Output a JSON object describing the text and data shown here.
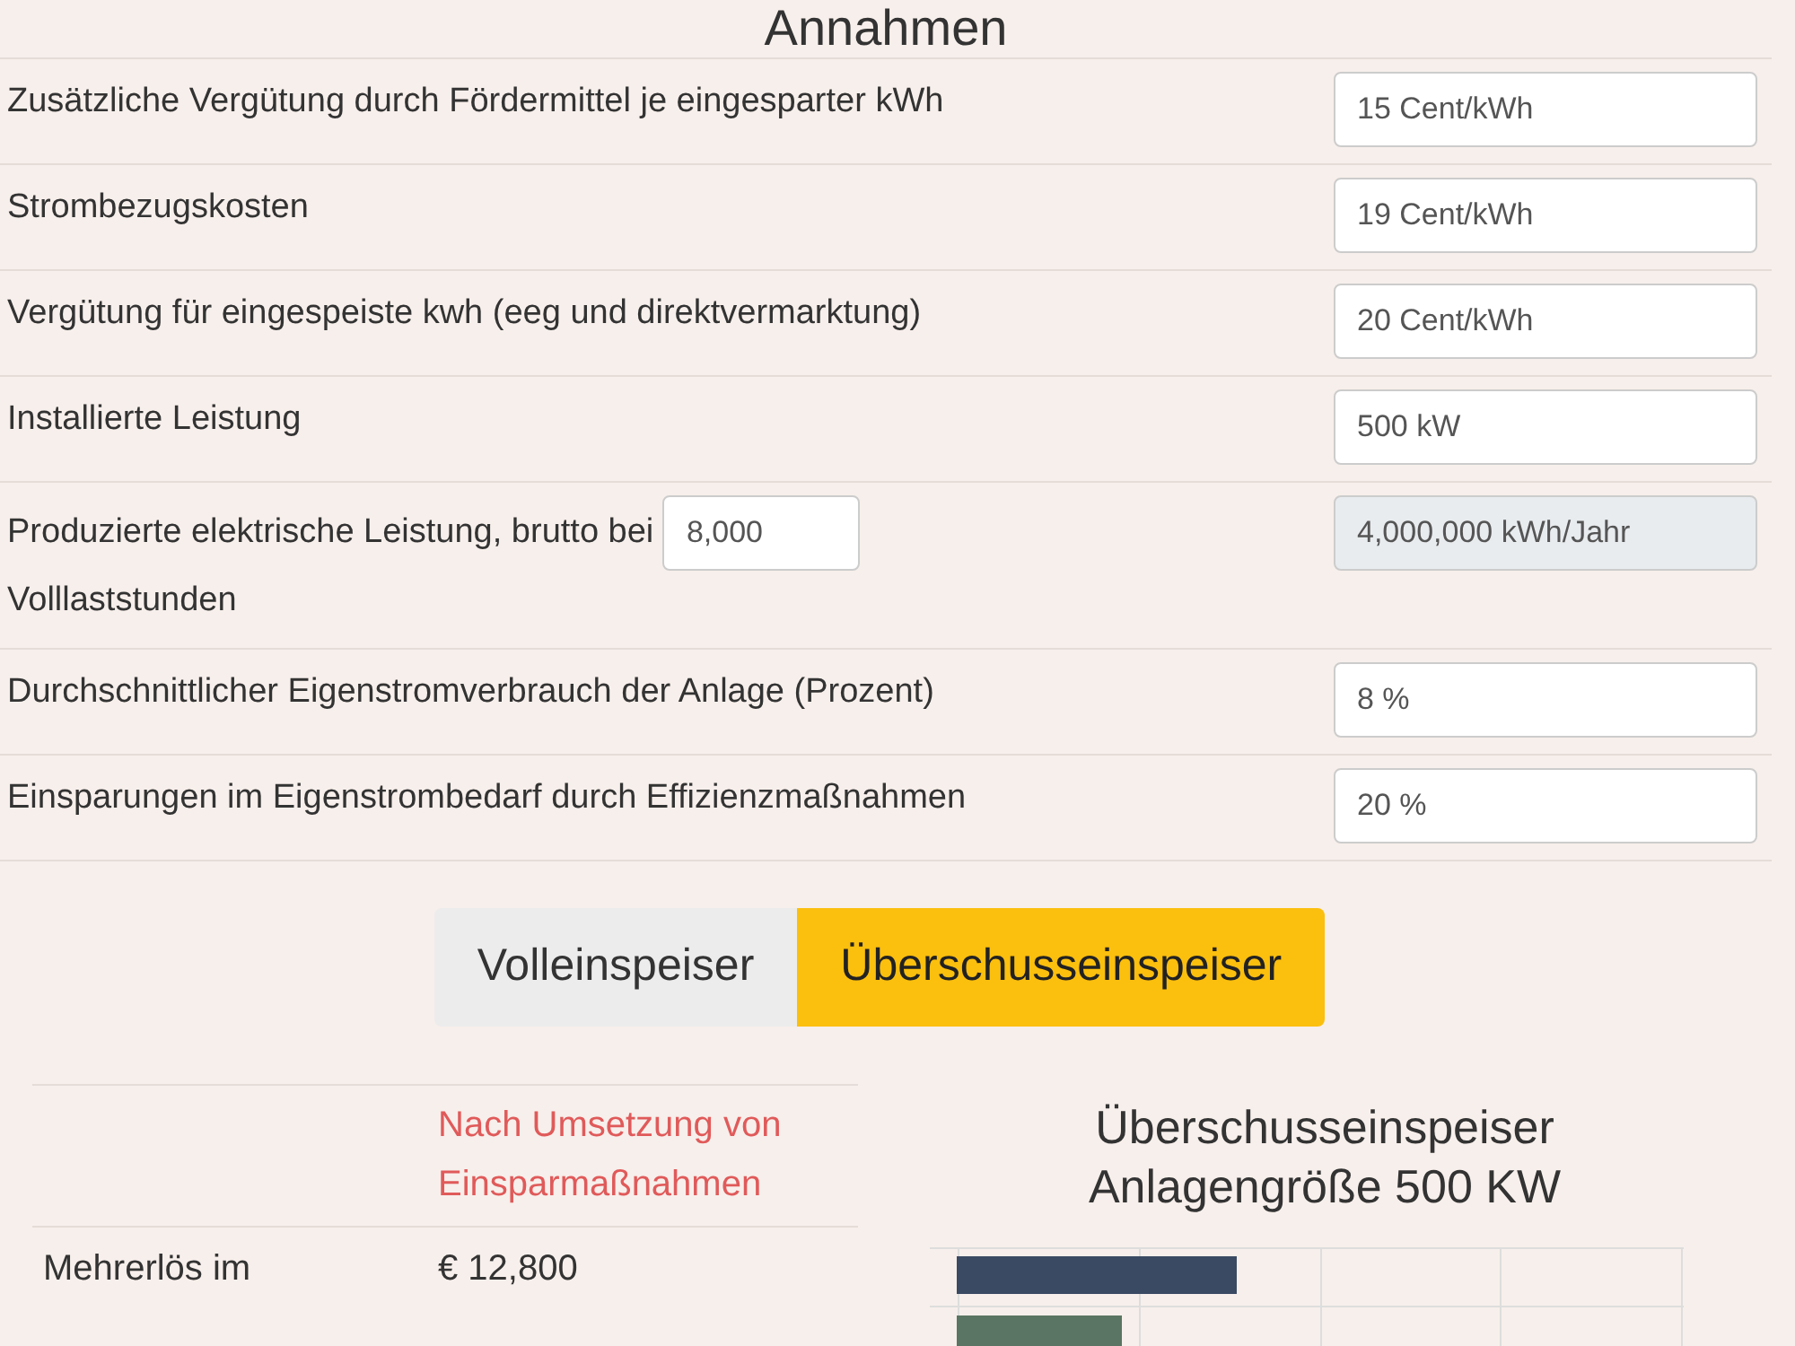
{
  "heading": "Annahmen",
  "assumptions": [
    {
      "label": "Zusätzliche Vergütung durch Fördermittel je eingesparter kWh",
      "value": "15 Cent/kWh",
      "disabled": false
    },
    {
      "label": "Strombezugskosten",
      "value": "19 Cent/kWh",
      "disabled": false
    },
    {
      "label": "Vergütung für eingespeiste kwh (eeg und direktvermarktung)",
      "value": "20 Cent/kWh",
      "disabled": false
    },
    {
      "label": "Installierte Leistung",
      "value": "500 kW",
      "disabled": false
    },
    {
      "label": "Produzierte elektrische Leistung, brutto bei",
      "inline_value": "8,000",
      "label_after": "Volllaststunden",
      "value": "4,000,000 kWh/Jahr",
      "disabled": true
    },
    {
      "label": "Durchschnittlicher Eigenstromverbrauch der Anlage (Prozent)",
      "value": "8 %",
      "disabled": false
    },
    {
      "label": "Einsparungen im Eigenstrombedarf durch Effizienzmaßnahmen",
      "value": "20 %",
      "disabled": false
    }
  ],
  "mode_tabs": [
    {
      "label": "Volleinspeiser",
      "selected": false
    },
    {
      "label": "Überschusseinspeiser",
      "selected": true
    }
  ],
  "results": {
    "header": "Nach Umsetzung von Einsparmaßnahmen",
    "rows": [
      {
        "label": "Mehrerlös im",
        "value": "€ 12,800"
      }
    ]
  },
  "chart": {
    "title_lines": [
      "Überschusseinspeiser",
      "Anlagengröße 500 KW"
    ]
  }
}
